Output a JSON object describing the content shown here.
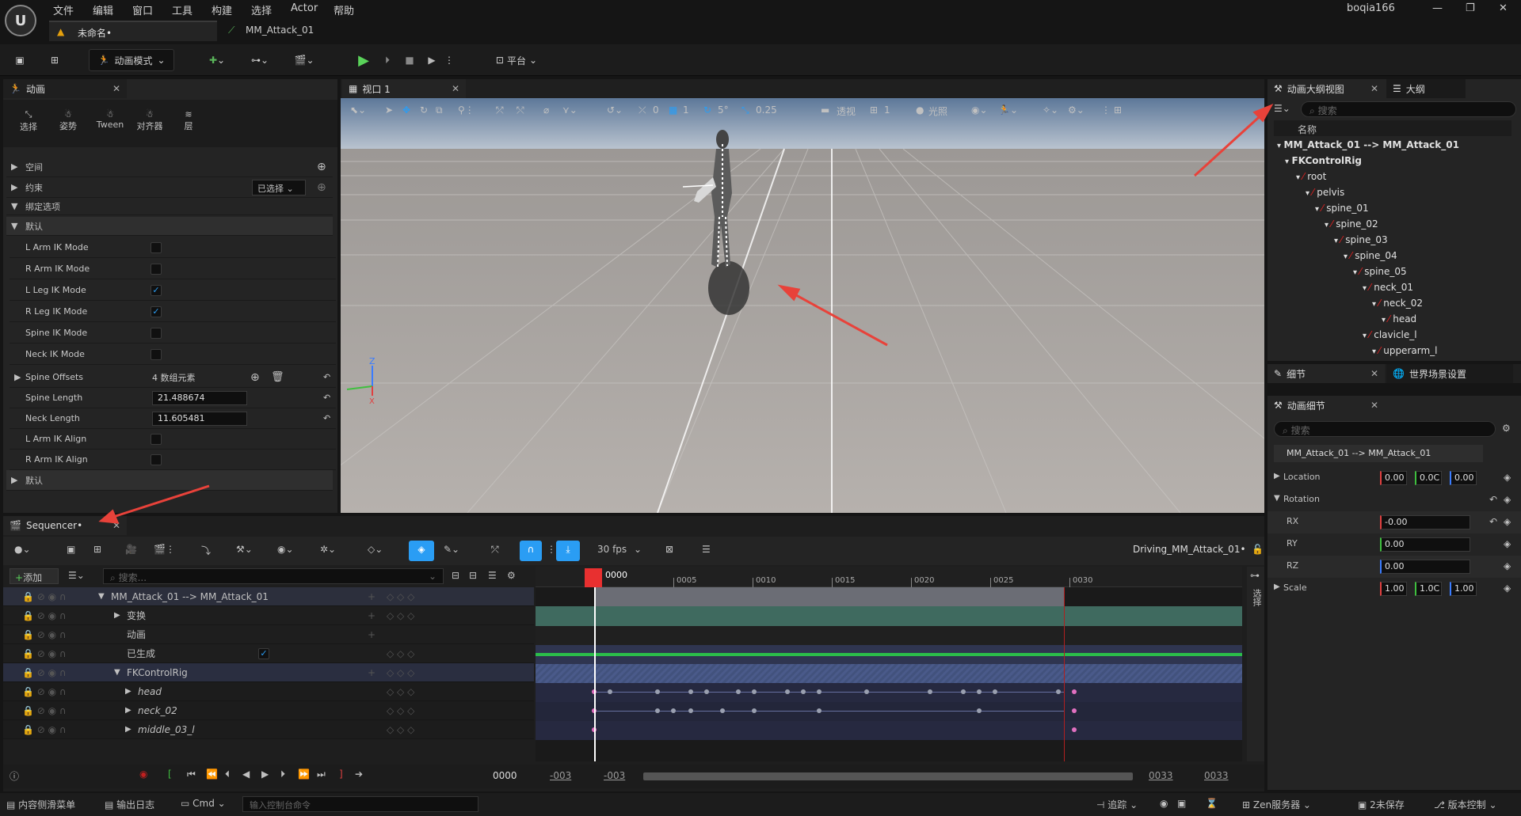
{
  "menu": [
    "文件",
    "编辑",
    "窗口",
    "工具",
    "构建",
    "选择",
    "Actor",
    "帮助"
  ],
  "user": "boqia166",
  "doc_tabs": [
    "未命名•",
    "MM_Attack_01"
  ],
  "toolbar": {
    "mode_label": "动画模式",
    "platform_label": "平台"
  },
  "anim_panel": {
    "tab": "动画",
    "tools": [
      "选择",
      "姿势",
      "Tween",
      "对齐器",
      "层"
    ],
    "sections": {
      "space": "空间",
      "constraint": "约束",
      "constraint_value": "已选择",
      "bind": "绑定选项",
      "default": "默认",
      "default2": "默认"
    },
    "props": [
      {
        "label": "L Arm IK Mode",
        "checked": false
      },
      {
        "label": "R Arm IK Mode",
        "checked": false
      },
      {
        "label": "L Leg IK Mode",
        "checked": true
      },
      {
        "label": "R Leg IK Mode",
        "checked": true
      },
      {
        "label": "Spine IK Mode",
        "checked": false
      },
      {
        "label": "Neck IK Mode",
        "checked": false
      }
    ],
    "spine_offsets": {
      "label": "Spine Offsets",
      "value": "4 数组元素"
    },
    "spine_length": {
      "label": "Spine Length",
      "value": "21.488674"
    },
    "neck_length": {
      "label": "Neck Length",
      "value": "11.605481"
    },
    "l_arm_align": "L Arm IK Align",
    "r_arm_align": "R Arm IK Align"
  },
  "viewport": {
    "tab": "视口 1",
    "toolbar": {
      "rot": "0",
      "grid": "1",
      "angle": "5°",
      "scale": "0.25",
      "view": "透视",
      "layer": "1",
      "lit": "光照"
    }
  },
  "outliner": {
    "tab1": "动画大纲视图",
    "tab2": "大纲",
    "search_placeholder": "搜索",
    "col": "名称",
    "items": [
      {
        "name": "MM_Attack_01 --> MM_Attack_01",
        "bone": false
      },
      {
        "name": "FKControlRig",
        "bone": false
      },
      {
        "name": "root",
        "bone": true
      },
      {
        "name": "pelvis",
        "bone": true
      },
      {
        "name": "spine_01",
        "bone": true
      },
      {
        "name": "spine_02",
        "bone": true
      },
      {
        "name": "spine_03",
        "bone": true
      },
      {
        "name": "spine_04",
        "bone": true
      },
      {
        "name": "spine_05",
        "bone": true
      },
      {
        "name": "neck_01",
        "bone": true
      },
      {
        "name": "neck_02",
        "bone": true
      },
      {
        "name": "head",
        "bone": true
      },
      {
        "name": "clavicle_l",
        "bone": true
      },
      {
        "name": "upperarm_l",
        "bone": true
      }
    ]
  },
  "details": {
    "tab1": "细节",
    "tab2": "世界场景设置"
  },
  "anim_details": {
    "tab": "动画细节",
    "search_placeholder": "搜索",
    "header": "MM_Attack_01 --> MM_Attack_01",
    "location": {
      "label": "Location",
      "x": "0.00",
      "y": "0.0C",
      "z": "0.00"
    },
    "rotation": {
      "label": "Rotation"
    },
    "rx": {
      "label": "RX",
      "value": "-0.00"
    },
    "ry": {
      "label": "RY",
      "value": "0.00"
    },
    "rz": {
      "label": "RZ",
      "value": "0.00"
    },
    "scale": {
      "label": "Scale",
      "x": "1.00",
      "y": "1.0C",
      "z": "1.00"
    }
  },
  "sequencer": {
    "tab": "Sequencer•",
    "fps": "30 fps",
    "sequence_name": "Driving_MM_Attack_01•",
    "add_label": "添加",
    "search_placeholder": "搜索...",
    "rows": [
      {
        "label": "MM_Attack_01 --> MM_Attack_01"
      },
      {
        "label": "变换"
      },
      {
        "label": "动画"
      },
      {
        "label": "已生成"
      },
      {
        "label": "FKControlRig"
      },
      {
        "label": "head"
      },
      {
        "label": "neck_02"
      },
      {
        "label": "middle_03_l"
      }
    ],
    "current_frame": "0000",
    "ticks": [
      "0005",
      "0010",
      "0015",
      "0020",
      "0025",
      "0030"
    ],
    "range": {
      "start1": "-003",
      "start2": "-003",
      "end1": "0033",
      "end2": "0033"
    },
    "frame_display": "0000",
    "side_label": "选择"
  },
  "status": {
    "content_drawer": "内容侧滑菜单",
    "output_log": "输出日志",
    "cmd": "Cmd",
    "cmd_placeholder": "输入控制台命令",
    "trace": "追踪",
    "zen": "Zen服务器",
    "unsaved": "2未保存",
    "revision": "版本控制"
  },
  "colors": {
    "accent": "#2a9df4",
    "bone": "#e02020",
    "playhead": "#e83030"
  }
}
